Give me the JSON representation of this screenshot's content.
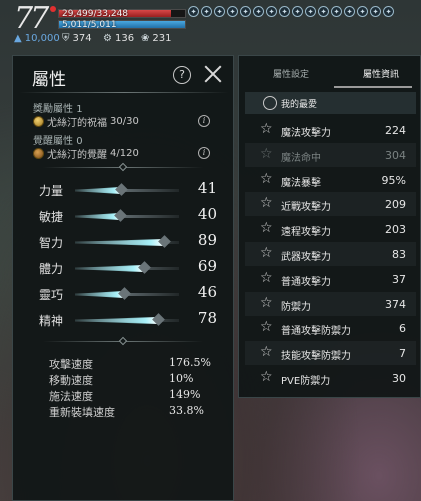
{
  "hud": {
    "level": "77",
    "hp_text": "29,499/33,248",
    "hp_fraction": 0.887,
    "mp_text": "5,011/5,011",
    "mp_fraction": 1.0,
    "power": "10,000",
    "currencies": [
      {
        "icon": "shield-icon",
        "value": "374"
      },
      {
        "icon": "token-icon",
        "value": "136"
      },
      {
        "icon": "crest-icon",
        "value": "231"
      }
    ],
    "buffs": [
      "buff-icon",
      "buff-icon",
      "buff-icon",
      "buff-icon",
      "buff-icon",
      "buff-icon",
      "buff-icon",
      "buff-icon",
      "buff-icon",
      "buff-icon",
      "buff-icon",
      "buff-icon",
      "buff-icon",
      "buff-icon",
      "buff-icon",
      "buff-icon"
    ]
  },
  "attributes_panel": {
    "title": "屬性",
    "reward_attr": {
      "label": "獎勵屬性",
      "value": "1",
      "item_name": "尤絲汀的祝福",
      "progress": "30/30"
    },
    "awaken_attr": {
      "label": "覺醒屬性",
      "value": "0",
      "item_name": "尤絲汀的覺醒",
      "progress": "4/120"
    },
    "stats": [
      {
        "name": "力量",
        "value": "41",
        "fill": 0.44
      },
      {
        "name": "敏捷",
        "value": "40",
        "fill": 0.43
      },
      {
        "name": "智力",
        "value": "89",
        "fill": 0.86
      },
      {
        "name": "體力",
        "value": "69",
        "fill": 0.66
      },
      {
        "name": "靈巧",
        "value": "46",
        "fill": 0.47
      },
      {
        "name": "精神",
        "value": "78",
        "fill": 0.8
      }
    ],
    "sub_stats": [
      {
        "name": "攻擊速度",
        "value": "176.5%"
      },
      {
        "name": "移動速度",
        "value": "10%"
      },
      {
        "name": "施法速度",
        "value": "149%"
      },
      {
        "name": "重新裝填速度",
        "value": "33.8%"
      }
    ]
  },
  "info_panel": {
    "tabs": [
      {
        "label": "屬性設定",
        "active": false
      },
      {
        "label": "屬性資訊",
        "active": true
      }
    ],
    "favorites_label": "我的最愛",
    "rows": [
      {
        "name": "魔法攻擊力",
        "value": "224",
        "dim": false
      },
      {
        "name": "魔法命中",
        "value": "304",
        "dim": true
      },
      {
        "name": "魔法暴擊",
        "value": "95%",
        "dim": false
      },
      {
        "name": "近戰攻擊力",
        "value": "209",
        "dim": false
      },
      {
        "name": "遠程攻擊力",
        "value": "203",
        "dim": false
      },
      {
        "name": "武器攻擊力",
        "value": "83",
        "dim": false
      },
      {
        "name": "普通攻擊力",
        "value": "37",
        "dim": false
      },
      {
        "name": "防禦力",
        "value": "374",
        "dim": false
      },
      {
        "name": "普通攻擊防禦力",
        "value": "6",
        "dim": false
      },
      {
        "name": "技能攻擊防禦力",
        "value": "7",
        "dim": false
      },
      {
        "name": "PVE防禦力",
        "value": "30",
        "dim": false
      }
    ]
  }
}
